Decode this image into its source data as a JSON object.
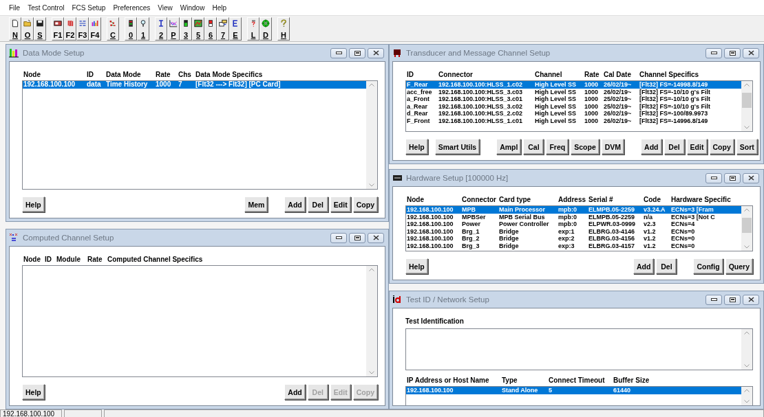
{
  "menu": [
    {
      "label": "File"
    },
    {
      "label": "Test Control"
    },
    {
      "label": "FCS Setup"
    },
    {
      "label": "Preferences"
    },
    {
      "label": "View"
    },
    {
      "label": "Window"
    },
    {
      "label": "Help"
    }
  ],
  "toolbar": {
    "groups": [
      [
        {
          "label": "N",
          "underlined": true
        },
        {
          "label": "O",
          "underlined": true
        },
        {
          "label": "S",
          "underlined": true
        }
      ],
      [
        {
          "label": "F1",
          "underlined": false
        },
        {
          "label": "F2",
          "underlined": false
        },
        {
          "label": "F3",
          "underlined": false
        },
        {
          "label": "F4",
          "underlined": false
        }
      ],
      [
        {
          "label": "C",
          "underlined": true
        }
      ],
      [
        {
          "label": "0",
          "underlined": true
        },
        {
          "label": "1",
          "underlined": true
        }
      ],
      [
        {
          "label": "2",
          "underlined": true
        },
        {
          "label": "P",
          "underlined": true
        },
        {
          "label": "3",
          "underlined": true
        },
        {
          "label": "5",
          "underlined": true
        },
        {
          "label": "6",
          "underlined": true
        },
        {
          "label": "7",
          "underlined": true
        },
        {
          "label": "E",
          "underlined": true
        }
      ],
      [
        {
          "label": "L",
          "underlined": true
        },
        {
          "label": "D",
          "underlined": true
        }
      ],
      [
        {
          "label": "H",
          "underlined": true
        }
      ]
    ]
  },
  "windows": [
    {
      "kind": "list",
      "title": "Data Mode Setup",
      "columns": [
        "Node",
        "ID",
        "Data Mode",
        "Rate",
        "Chs",
        "Data Mode Specifics"
      ],
      "rows": [
        {
          "cells": [
            "192.168.100.100",
            "data",
            "Time History",
            "1000",
            "7",
            "[Flt32 ---> Flt32] [PC Card]"
          ],
          "selected": true
        }
      ],
      "button_groups": [
        [
          {
            "label": "Help",
            "disabled": false
          }
        ],
        [
          {
            "label": "Mem",
            "disabled": false
          }
        ],
        [
          {
            "label": "Add",
            "disabled": false
          },
          {
            "label": "Del",
            "disabled": false
          },
          {
            "label": "Edit",
            "disabled": false
          },
          {
            "label": "Copy",
            "disabled": false
          }
        ]
      ]
    },
    {
      "kind": "list",
      "title": "Computed Channel Setup",
      "columns": [
        "Node",
        "ID",
        "Module",
        "Rate",
        "Computed Channel Specifics"
      ],
      "button_groups": [
        [
          {
            "label": "Help",
            "disabled": false
          }
        ],
        [
          {
            "label": "Add",
            "disabled": false
          },
          {
            "label": "Del",
            "disabled": true
          },
          {
            "label": "Edit",
            "disabled": true
          },
          {
            "label": "Copy",
            "disabled": true
          }
        ]
      ]
    },
    {
      "kind": "list",
      "title": "Transducer and Message Channel Setup",
      "columns": [
        "ID",
        "Connector",
        "Channel",
        "Rate",
        "Cal Date",
        "Channel Specifics"
      ],
      "rows": [
        {
          "cells": [
            "F_Rear",
            "192.168.100.100:HLSS_1.c02",
            "High Level SS",
            "1000",
            "26/02/19~",
            "[Flt32] FS=-14998.8/149"
          ],
          "selected": true
        },
        {
          "cells": [
            "acc_free",
            "192.168.100.100:HLSS_3.c03",
            "High Level SS",
            "1000",
            "26/02/19~",
            "[Flt32] FS=-10/10 g's Filt"
          ],
          "selected": false
        },
        {
          "cells": [
            "a_Front",
            "192.168.100.100:HLSS_3.c01",
            "High Level SS",
            "1000",
            "25/02/19~",
            "[Flt32] FS=-10/10 g's Filt"
          ],
          "selected": false
        },
        {
          "cells": [
            "a_Rear",
            "192.168.100.100:HLSS_3.c02",
            "High Level SS",
            "1000",
            "25/02/19~",
            "[Flt32] FS=-10/10 g's Filt"
          ],
          "selected": false
        },
        {
          "cells": [
            "d_Rear",
            "192.168.100.100:HLSS_2.c02",
            "High Level SS",
            "1000",
            "26/02/19~",
            "[Flt32] FS=-100/89.9973"
          ],
          "selected": false
        },
        {
          "cells": [
            "F_Front",
            "192.168.100.100:HLSS_1.c01",
            "High Level SS",
            "1000",
            "26/02/19~",
            "[Flt32] FS=-14996.8/149"
          ],
          "selected": false
        }
      ],
      "button_groups": [
        [
          {
            "label": "Help",
            "disabled": false
          },
          {
            "label": "Smart Utils",
            "disabled": false
          }
        ],
        [
          {
            "label": "Ampl",
            "disabled": false
          },
          {
            "label": "Cal",
            "disabled": false
          },
          {
            "label": "Freq",
            "disabled": false
          },
          {
            "label": "Scope",
            "disabled": false
          },
          {
            "label": "DVM",
            "disabled": false
          }
        ],
        [
          {
            "label": "Add",
            "disabled": false
          },
          {
            "label": "Del",
            "disabled": false
          },
          {
            "label": "Edit",
            "disabled": false
          },
          {
            "label": "Copy",
            "disabled": false
          },
          {
            "label": "Sort",
            "disabled": false
          }
        ]
      ]
    },
    {
      "kind": "list",
      "title": "Hardware Setup [100000 Hz]",
      "columns": [
        "Node",
        "Connector",
        "Card type",
        "Address",
        "Serial #",
        "Code",
        "Hardware Specific"
      ],
      "rows": [
        {
          "cells": [
            "192.168.100.100",
            "MPB",
            "Main Processor",
            "mpb:0",
            "ELMPB.05-2259",
            "v3.24.A",
            "ECNs=3 [Fram"
          ],
          "selected": true
        },
        {
          "cells": [
            "192.168.100.100",
            "MPBSer",
            "MPB Serial Bus",
            "mpb:0",
            "ELMPB.05-2259",
            "n/a",
            "ECNs=3 [Not C"
          ],
          "selected": false
        },
        {
          "cells": [
            "192.168.100.100",
            "Power",
            "Power Controller",
            "mpb:0",
            "ELPWR.03-0999",
            "v2.3",
            "ECNs=4"
          ],
          "selected": false
        },
        {
          "cells": [
            "192.168.100.100",
            "Brg_1",
            "Bridge",
            "exp:1",
            "ELBRG.03-4146",
            "v1.2",
            "ECNs=0"
          ],
          "selected": false
        },
        {
          "cells": [
            "192.168.100.100",
            "Brg_2",
            "Bridge",
            "exp:2",
            "ELBRG.03-4156",
            "v1.2",
            "ECNs=0"
          ],
          "selected": false
        },
        {
          "cells": [
            "192.168.100.100",
            "Brg_3",
            "Bridge",
            "exp:3",
            "ELBRG.03-4157",
            "v1.2",
            "ECNs=0"
          ],
          "selected": false
        }
      ],
      "button_groups": [
        [
          {
            "label": "Help",
            "disabled": false
          }
        ],
        [
          {
            "label": "Add",
            "disabled": false
          },
          {
            "label": "Del",
            "disabled": false
          }
        ],
        [
          {
            "label": "Config",
            "disabled": false
          },
          {
            "label": "Query",
            "disabled": false
          }
        ]
      ]
    },
    {
      "kind": "network",
      "title": "Test ID / Network Setup",
      "field_label": "Test Identification",
      "columns": [
        "IP Address or Host Name",
        "Type",
        "Connect Timeout",
        "Buffer Size"
      ],
      "rows": [
        {
          "cells": [
            "192.168.100.100",
            "Stand Alone",
            "5",
            "61440"
          ],
          "selected": true
        }
      ]
    }
  ],
  "status_bar": {
    "panes": [
      {
        "text": "192.168.100.100"
      }
    ]
  }
}
